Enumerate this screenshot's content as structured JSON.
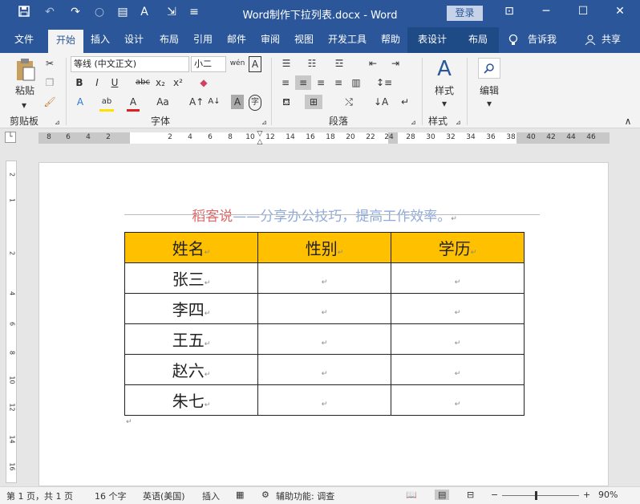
{
  "title_bar": {
    "document_title": "Word制作下拉列表.docx  -  Word",
    "login_label": "登录",
    "quick_access": [
      "save-icon",
      "undo-icon",
      "redo-icon",
      "circle-icon",
      "new-doc-icon",
      "font-color-icon",
      "format-painter-icon",
      "customize-icon"
    ]
  },
  "tabs": [
    "文件",
    "开始",
    "插入",
    "设计",
    "布局",
    "引用",
    "邮件",
    "审阅",
    "视图",
    "开发工具",
    "帮助",
    "表设计",
    "布局"
  ],
  "active_tab": "开始",
  "tell_me": "告诉我",
  "share": "共享",
  "ribbon": {
    "clipboard": {
      "paste_label": "粘贴",
      "group_label": "剪贴板"
    },
    "font": {
      "font_name": "等线 (中文正文)",
      "font_size": "小二",
      "group_label": "字体",
      "buttons": [
        "B",
        "I",
        "U",
        "abc",
        "x₂",
        "x²",
        "A",
        "Aa",
        "A↑",
        "A↓",
        "A"
      ]
    },
    "paragraph": {
      "group_label": "段落"
    },
    "styles": {
      "label": "样式",
      "group_label": "样式"
    },
    "editing": {
      "label": "编辑"
    }
  },
  "ruler": {
    "left_numbers": [
      "8",
      "6",
      "4",
      "2"
    ],
    "mid_numbers": [
      "2",
      "4",
      "6",
      "8",
      "10",
      "12",
      "14",
      "16",
      "18",
      "20",
      "22",
      "24"
    ],
    "right_numbers": [
      "28",
      "30",
      "32",
      "34",
      "36",
      "38",
      "40",
      "42",
      "44",
      "46"
    ],
    "vertical_numbers": [
      "2",
      "1",
      "2",
      "4",
      "6",
      "8",
      "10",
      "12",
      "14",
      "16"
    ]
  },
  "document": {
    "subtitle_prefix": "稻客说",
    "subtitle_rest": "——分享办公技巧，提高工作效率。",
    "table": {
      "headers": [
        "姓名",
        "性别",
        "学历"
      ],
      "rows": [
        [
          "张三",
          "",
          ""
        ],
        [
          "李四",
          "",
          ""
        ],
        [
          "王五",
          "",
          ""
        ],
        [
          "赵六",
          "",
          ""
        ],
        [
          "朱七",
          "",
          ""
        ]
      ]
    }
  },
  "status_bar": {
    "page": "第 1 页，共 1 页",
    "words": "16 个字",
    "language": "英语(美国)",
    "mode": "插入",
    "accessibility": "辅助功能: 调查",
    "zoom": "90%"
  },
  "colors": {
    "title_blue": "#2b579a",
    "header_fill": "#ffc000",
    "subtitle_red": "#e06666",
    "subtitle_blue": "#8eaadb"
  }
}
